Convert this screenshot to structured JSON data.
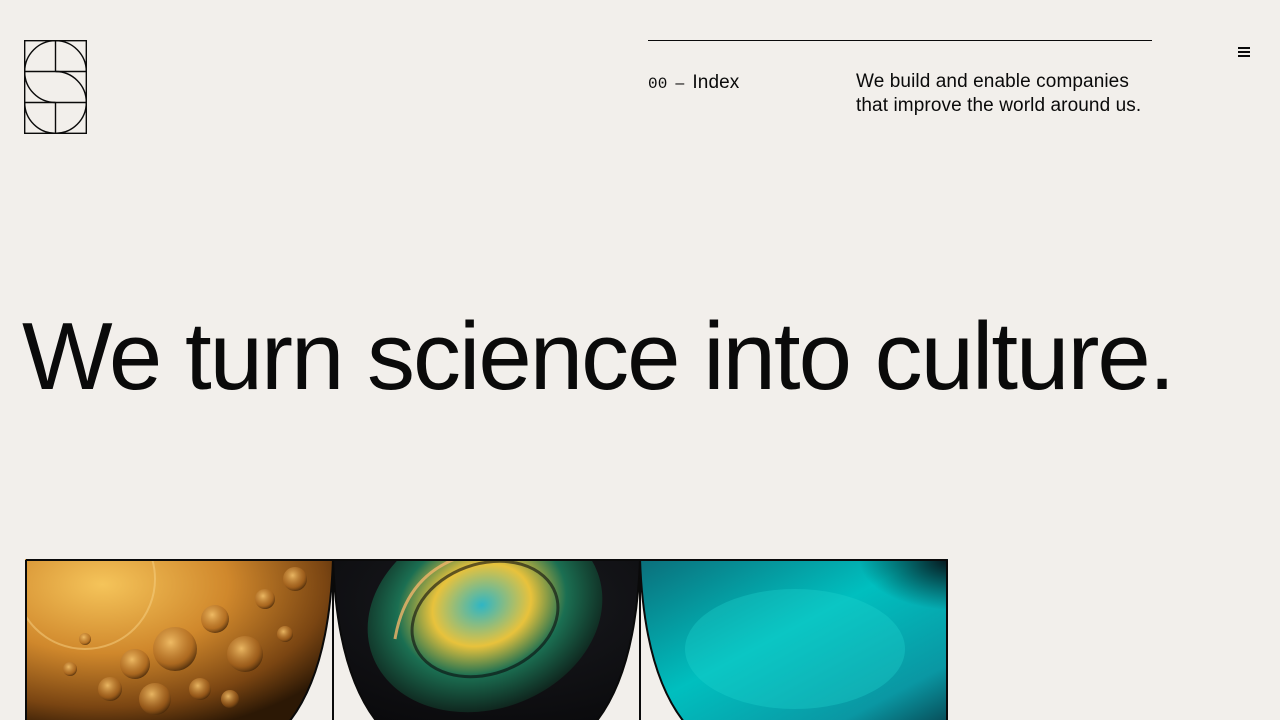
{
  "brand": {
    "logo_icon": "s-monogram-icon"
  },
  "header": {
    "index": {
      "number": "00",
      "separator": "–",
      "label": "Index"
    },
    "intro": "We build and enable companies that improve the world around us.",
    "menu_icon": "hamburger-menu-icon"
  },
  "hero": {
    "headline": "We turn science into culture."
  },
  "gallery": {
    "images": [
      {
        "subject": "amber oil bubbles",
        "colors": [
          "#f0b44a",
          "#b46c1c",
          "#3d2406"
        ]
      },
      {
        "subject": "iridescent drop on dark",
        "colors": [
          "#f3c846",
          "#1d9fb2",
          "#121214"
        ]
      },
      {
        "subject": "teal liquid surface",
        "colors": [
          "#00c4c2",
          "#0a7f8a",
          "#071018"
        ]
      }
    ]
  },
  "colors": {
    "background": "#f2efeb",
    "ink": "#0a0a0a"
  }
}
